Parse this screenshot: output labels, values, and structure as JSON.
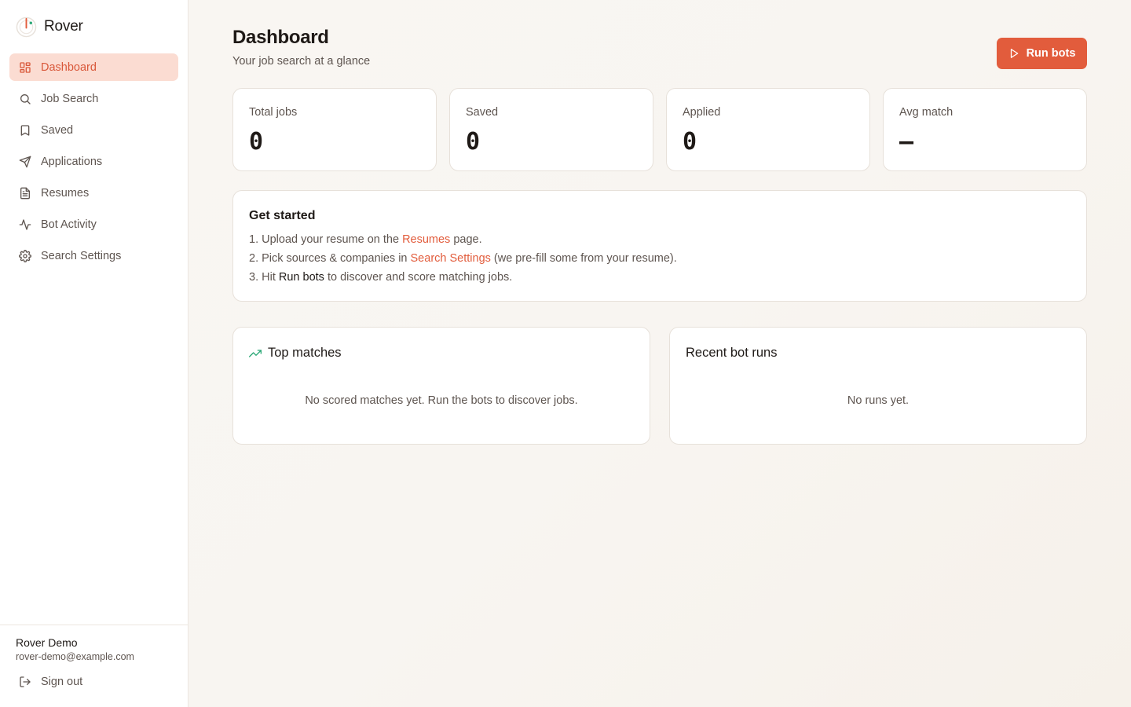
{
  "app": {
    "name": "Rover"
  },
  "colors": {
    "accent": "#e25c3c",
    "active_bg": "#fbdcd2",
    "trend": "#2aa876"
  },
  "sidebar": {
    "items": [
      {
        "label": "Dashboard",
        "icon": "dashboard-icon",
        "active": true
      },
      {
        "label": "Job Search",
        "icon": "search-icon"
      },
      {
        "label": "Saved",
        "icon": "bookmark-icon"
      },
      {
        "label": "Applications",
        "icon": "send-icon"
      },
      {
        "label": "Resumes",
        "icon": "document-icon"
      },
      {
        "label": "Bot Activity",
        "icon": "activity-icon"
      },
      {
        "label": "Search Settings",
        "icon": "gear-icon"
      }
    ],
    "user": {
      "name": "Rover Demo",
      "email": "rover-demo@example.com"
    },
    "signout_label": "Sign out"
  },
  "header": {
    "title": "Dashboard",
    "subtitle": "Your job search at a glance",
    "run_button_label": "Run bots"
  },
  "stats": [
    {
      "label": "Total jobs",
      "value": "0"
    },
    {
      "label": "Saved",
      "value": "0"
    },
    {
      "label": "Applied",
      "value": "0"
    },
    {
      "label": "Avg match",
      "value": "—"
    }
  ],
  "get_started": {
    "title": "Get started",
    "step1": {
      "prefix": "1. Upload your resume on the ",
      "link": "Resumes",
      "suffix": " page."
    },
    "step2": {
      "prefix": "2. Pick sources & companies in ",
      "link": "Search Settings",
      "suffix": " (we pre-fill some from your resume)."
    },
    "step3": {
      "prefix": "3. Hit ",
      "strong": "Run bots",
      "suffix": " to discover and score matching jobs."
    }
  },
  "top_matches": {
    "title": "Top matches",
    "empty": "No scored matches yet. Run the bots to discover jobs."
  },
  "recent_runs": {
    "title": "Recent bot runs",
    "empty": "No runs yet."
  }
}
